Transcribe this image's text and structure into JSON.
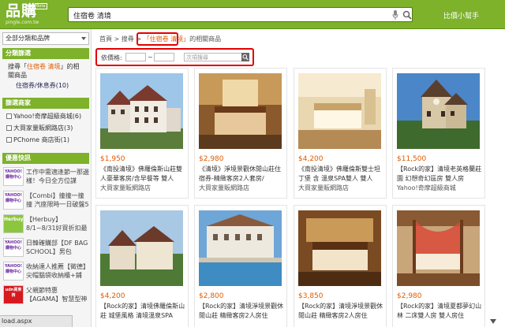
{
  "header": {
    "logo_text": "品購",
    "logo_sub": "pingle.com.tw",
    "logo_badge": "Beta",
    "search_value": "住宿卷 清境",
    "compare_link": "比價小幫手"
  },
  "sidebar": {
    "category_select": "全部分類和品牌",
    "filter_head": "分類篩選",
    "search_prefix": "搜尋「",
    "search_term": "住宿卷 清境",
    "search_suffix": "」的相",
    "search_line2": "關商品",
    "category_item": "住宿券/休息券(10)",
    "shop_head": "篩選商家",
    "shops": [
      "Yahoo!奇摩超級商城(6)",
      "大買家量販網路店(3)",
      "PChome 商店街(1)"
    ],
    "deals_head": "優惠快訊",
    "deals": [
      {
        "logo": "YAHOO! 購物中心",
        "text": "工作中需適逢節一那邊樣！今日全方位謀"
      },
      {
        "logo": "YAHOO! 購物中心",
        "text": "【Combi】撞撞一撞撞 汽座限時一日破盤5"
      },
      {
        "logo": "Herbuy",
        "text": "【Herbuy】8/1~8/31好買折扣最點購~"
      },
      {
        "logo": "YAHOO! 購物中心",
        "text": "日韓確購部【DF BAG SCHOOL】男包"
      },
      {
        "logo": "YAHOO! 購物中心",
        "text": "收納達人推薦【徵德】尖帽腦袋收納櫃+鋪"
      },
      {
        "logo": "udn買東西",
        "text": "父親節特惠【AGAMA】智慧型神遊機器"
      }
    ]
  },
  "breadcrumb": {
    "home": "首頁",
    "sep": ">",
    "search": "搜尋",
    "term": "住宿卷 清境",
    "suffix": "的相關商品"
  },
  "filter": {
    "price_label": "依價格:",
    "sep": "~",
    "sub_search_placeholder": "次項搜尋"
  },
  "products": [
    {
      "price": "$1,950",
      "title": "《南投清境》佛羅倫斯山莊雙人豪華客房/含早餐等 雙人",
      "shop": "大買家量販網路店"
    },
    {
      "price": "$2,980",
      "title": "《清境》淨境景觀休閒山莊住宿券-精緻客房2人套房/",
      "shop": "大買家量販網路店"
    },
    {
      "price": "$4,200",
      "title": "《南投清境》佛羅倫斯雙士坦丁堡 含 溫泉SPA雙人 雙人",
      "shop": "大買家量販網路店"
    },
    {
      "price": "$11,500",
      "title": "【Rock的家】清境老英格蘭莊園 幻想奇幻區房 雙人房",
      "shop": "Yahoo!奇摩超級商城"
    },
    {
      "price": "$4,200",
      "title": "【Rock的家】清境佛羅倫斯山莊 城堡風格 清境溫泉SPA",
      "shop": ""
    },
    {
      "price": "$2,800",
      "title": "【Rock的家】清境淨境景觀休閒山莊 精緻客房2人房住",
      "shop": ""
    },
    {
      "price": "$3,850",
      "title": "【Rock的家】清境淨境景觀休閒山莊 精緻客房2人房住",
      "shop": ""
    },
    {
      "price": "$2,980",
      "title": "【Rock的家】清境夏都夢幻山林 二床雙人房 雙人房住",
      "shop": ""
    }
  ],
  "status_bar": "load.aspx"
}
